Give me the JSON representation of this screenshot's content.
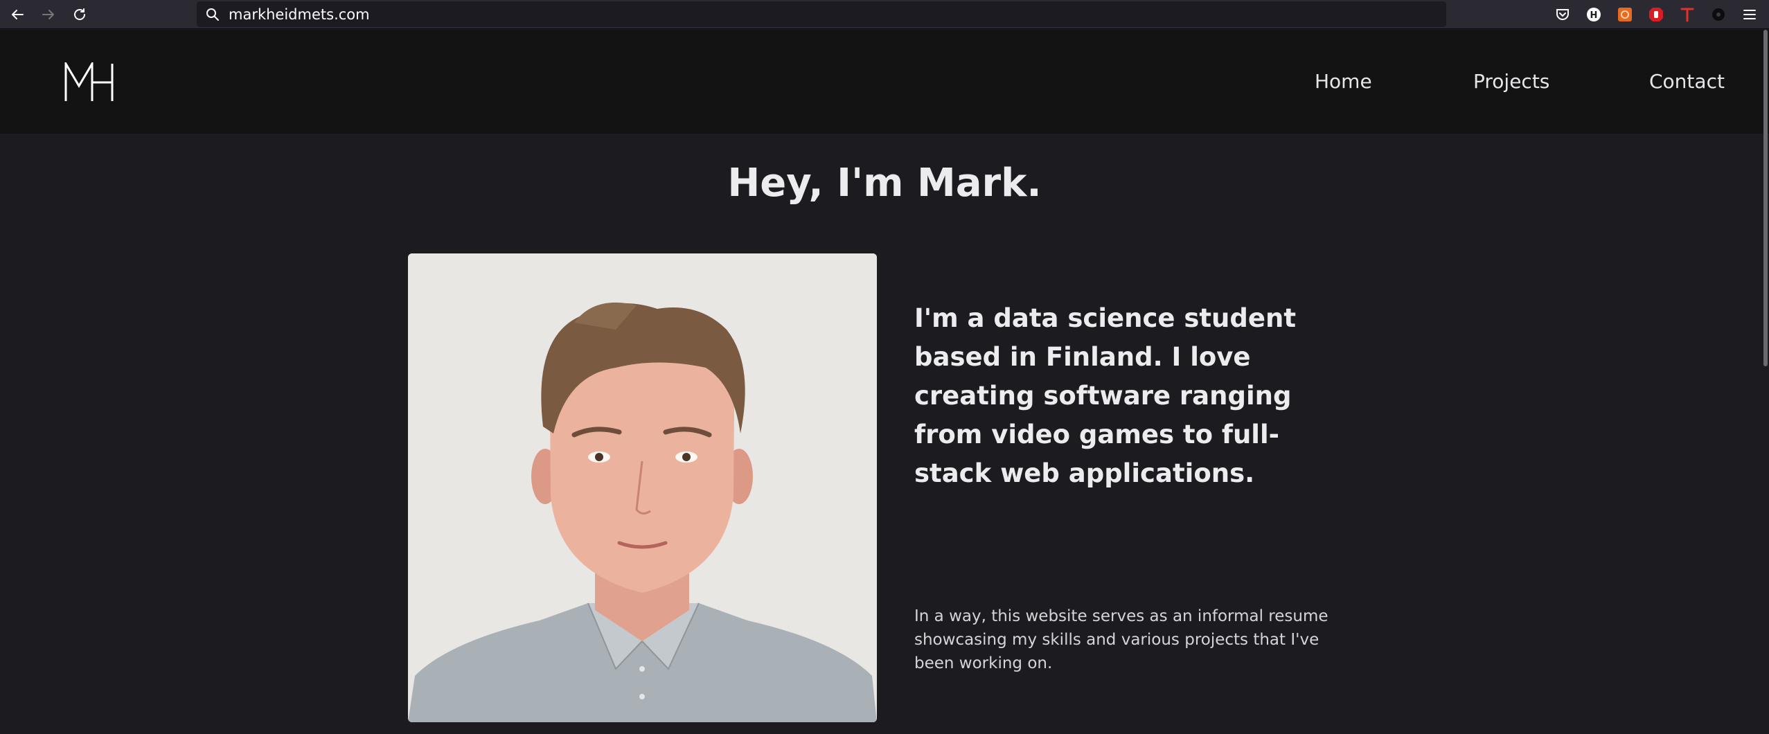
{
  "browser": {
    "url": "markheidmets.com",
    "icons": [
      "back-arrow-icon",
      "forward-arrow-icon",
      "reload-icon",
      "search-icon",
      "pocket-icon",
      "h-extension-icon",
      "orange-extension-icon",
      "red-stop-extension-icon",
      "t-extension-icon",
      "dark-extension-icon",
      "menu-icon"
    ]
  },
  "header": {
    "logo": "MH",
    "nav": [
      "Home",
      "Projects",
      "Contact"
    ]
  },
  "main": {
    "title": "Hey, I'm Mark.",
    "intro": "I'm a data science student based in Finland. I love creating software ranging from video games to full-stack web applications.",
    "subtext": "In a way, this website serves as an informal resume showcasing my skills and various projects that I've been working on."
  },
  "colors": {
    "page_background": "#1c1b1f",
    "header_background": "#131314",
    "text": "#ececef"
  }
}
